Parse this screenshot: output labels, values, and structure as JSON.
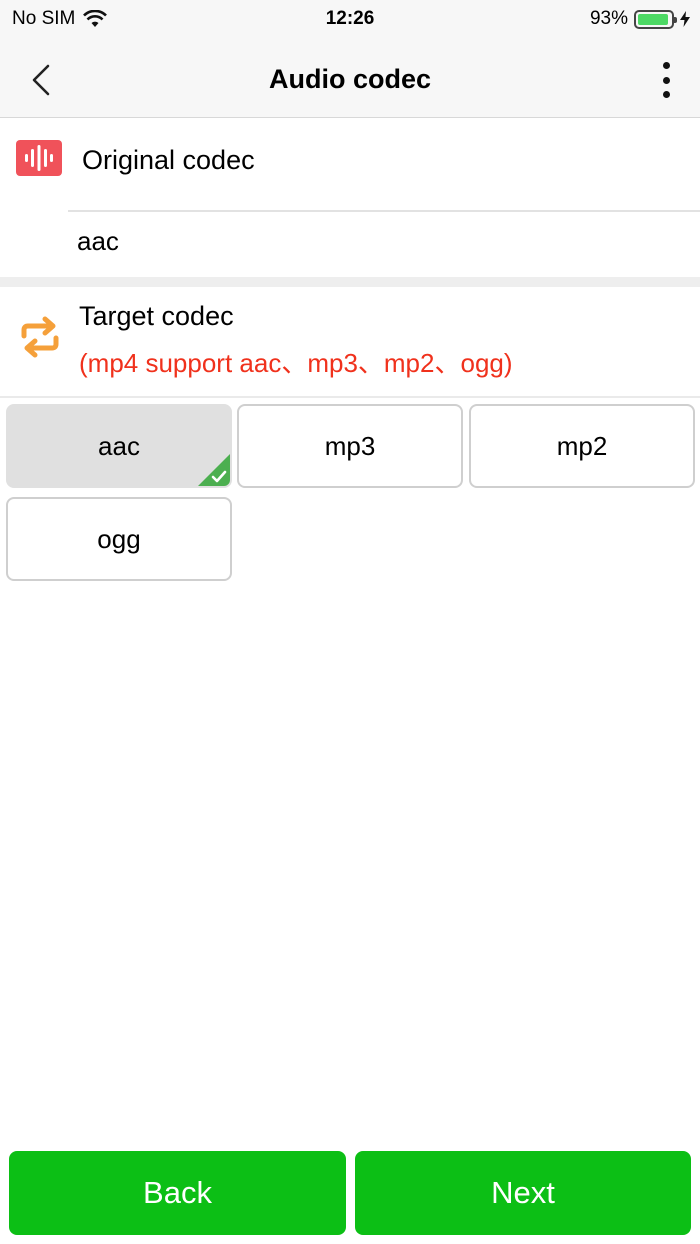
{
  "status": {
    "carrier": "No SIM",
    "time": "12:26",
    "battery": "93%",
    "battery_level": 0.93
  },
  "nav": {
    "title": "Audio codec"
  },
  "original": {
    "label": "Original codec",
    "value": "aac"
  },
  "target": {
    "label": "Target codec",
    "hint": "(mp4 support aac、mp3、mp2、ogg)"
  },
  "options": [
    {
      "label": "aac",
      "selected": true
    },
    {
      "label": "mp3",
      "selected": false
    },
    {
      "label": "mp2",
      "selected": false
    },
    {
      "label": "ogg",
      "selected": false
    }
  ],
  "buttons": {
    "back": "Back",
    "next": "Next"
  },
  "colors": {
    "accent_green": "#0cbf15",
    "hint_red": "#f0311c",
    "original_icon": "#f0525a",
    "target_icon": "#f5a03a"
  },
  "icons": {
    "original": "audio-wave-icon",
    "target": "convert-arrows-icon",
    "selected": "check-icon"
  }
}
